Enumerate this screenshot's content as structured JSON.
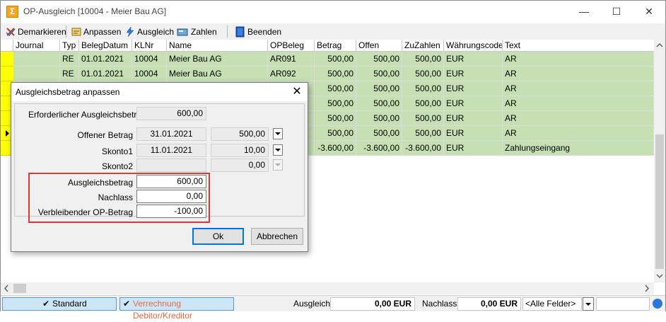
{
  "window": {
    "title": "OP-Ausgleich [10004 - Meier Bau AG]",
    "minimize": "—",
    "maximize": "☐",
    "close": "✕"
  },
  "toolbar": {
    "demarkieren": "Demarkieren",
    "anpassen": "Anpassen",
    "ausgleich": "Ausgleich",
    "zahlen": "Zahlen",
    "beenden": "Beenden"
  },
  "grid": {
    "columns": [
      "Journal",
      "Typ",
      "BelegDatum",
      "KLNr",
      "Name",
      "OPBeleg",
      "Betrag",
      "Offen",
      "ZuZahlen",
      "Währungscode",
      "Text"
    ],
    "rows": [
      {
        "journal": "",
        "typ": "RE",
        "datum": "01.01.2021",
        "klnr": "10004",
        "name": "Meier Bau AG",
        "opbeleg": "AR091",
        "betrag": "500,00",
        "offen": "500,00",
        "zuzahlen": "500,00",
        "waehrung": "EUR",
        "text": "AR"
      },
      {
        "journal": "",
        "typ": "RE",
        "datum": "01.01.2021",
        "klnr": "10004",
        "name": "Meier Bau AG",
        "opbeleg": "AR092",
        "betrag": "500,00",
        "offen": "500,00",
        "zuzahlen": "500,00",
        "waehrung": "EUR",
        "text": "AR"
      },
      {
        "journal": "",
        "typ": "",
        "datum": "",
        "klnr": "",
        "name": "",
        "opbeleg": "",
        "betrag": "500,00",
        "offen": "500,00",
        "zuzahlen": "500,00",
        "waehrung": "EUR",
        "text": "AR"
      },
      {
        "journal": "",
        "typ": "",
        "datum": "",
        "klnr": "",
        "name": "",
        "opbeleg": "",
        "betrag": "500,00",
        "offen": "500,00",
        "zuzahlen": "500,00",
        "waehrung": "EUR",
        "text": "AR"
      },
      {
        "journal": "",
        "typ": "",
        "datum": "",
        "klnr": "",
        "name": "",
        "opbeleg": "",
        "betrag": "500,00",
        "offen": "500,00",
        "zuzahlen": "500,00",
        "waehrung": "EUR",
        "text": "AR"
      },
      {
        "journal": "",
        "typ": "",
        "datum": "",
        "klnr": "",
        "name": "",
        "opbeleg": "",
        "betrag": "500,00",
        "offen": "500,00",
        "zuzahlen": "500,00",
        "waehrung": "EUR",
        "text": "AR"
      },
      {
        "journal": "",
        "typ": "",
        "datum": "",
        "klnr": "",
        "name": "",
        "opbeleg": "",
        "betrag": "-3.600,00",
        "offen": "-3.600,00",
        "zuzahlen": "-3.600,00",
        "waehrung": "EUR",
        "text": "Zahlungseingang"
      }
    ]
  },
  "statusbar": {
    "standard": "Standard",
    "verrechnung": "Verrechnung Debitor/Kreditor",
    "ausgleich_label": "Ausgleich",
    "ausgleich_value": "0,00 EUR",
    "nachlass_label": "Nachlass",
    "nachlass_value": "0,00 EUR",
    "filter_value": "<Alle Felder>"
  },
  "dialog": {
    "title": "Ausgleichsbetrag anpassen",
    "close": "✕",
    "erforderlich_label": "Erforderlicher Ausgleichsbetrag",
    "erforderlich_value": "600,00",
    "offener_label": "Offener Betrag",
    "offener_date": "31.01.2021",
    "offener_value": "500,00",
    "skonto1_label": "Skonto1",
    "skonto1_date": "11.01.2021",
    "skonto1_value": "10,00",
    "skonto2_label": "Skonto2",
    "skonto2_date": "",
    "skonto2_value": "0,00",
    "ausgleichsbetrag_label": "Ausgleichsbetrag",
    "ausgleichsbetrag_value": "600,00",
    "nachlass_label": "Nachlass",
    "nachlass_value": "0,00",
    "verbleibend_label": "Verbleibender OP-Betrag",
    "verbleibend_value": "-100,00",
    "ok": "Ok",
    "abbrechen": "Abbrechen"
  }
}
